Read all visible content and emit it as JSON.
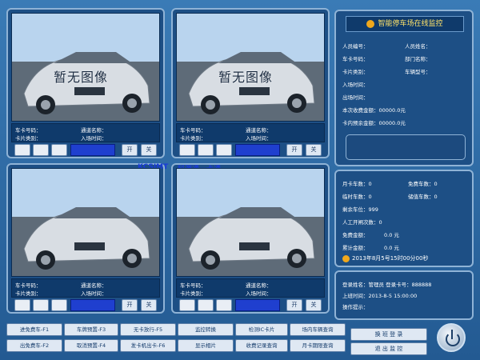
{
  "cams": [
    {
      "overlay": "暂无图像",
      "plate_label": "车卡号码：",
      "channel_label": "通道名称：",
      "cardtype_label": "卡片类别：",
      "entry_label": "入场时间：",
      "tag": ""
    },
    {
      "overlay": "暂无图像",
      "plate_label": "车卡号码：",
      "channel_label": "通道名称：",
      "cardtype_label": "卡片类别：",
      "entry_label": "入场时间：",
      "tag": ""
    },
    {
      "overlay": "",
      "plate_label": "车卡号码：",
      "channel_label": "通道名称：",
      "cardtype_label": "卡片类别：",
      "entry_label": "入场时间：",
      "tag": "KCSIMT"
    },
    {
      "overlay": "",
      "plate_label": "车卡号码：",
      "channel_label": "通道名称：",
      "cardtype_label": "卡片类别：",
      "entry_label": "入场时间：",
      "tag": "科源通一卡通"
    }
  ],
  "cam_buttons": {
    "open": "开",
    "close": "关"
  },
  "monitor": {
    "title": "智能停车场在线监控",
    "rows": [
      [
        "人员编号：",
        "人员姓名："
      ],
      [
        "车卡号码：",
        "部门名称："
      ],
      [
        "卡片类别：",
        "车辆型号："
      ],
      [
        "入场时间：",
        ""
      ],
      [
        "出场时间：",
        ""
      ],
      [
        "本次收费金额：00000.0元",
        ""
      ],
      [
        "卡内预余金额：00000.0元",
        ""
      ]
    ]
  },
  "stats": {
    "rows": [
      [
        "月卡车数：0",
        "免费车数：0"
      ],
      [
        "临时车数：0",
        "储值车数：0"
      ],
      [
        "剩余车位：999",
        ""
      ],
      [
        "人工开闸次数：0",
        ""
      ],
      [
        "免费金额：",
        "0.0  元"
      ],
      [
        "累计金额：",
        "0.0  元"
      ]
    ],
    "datetime": "2013年8月5号15时00分00秒"
  },
  "login": {
    "user": "登录姓名：管理员   登录卡号：888888",
    "shift": "上班时间：2013-8-5  15:00:00",
    "tip": "操作提示："
  },
  "buttons": [
    "进免费车-F1",
    "车牌预置-F3",
    "无卡放行-F5",
    "监控转换",
    "检测IC卡片",
    "场内车辆查询",
    "出免费车-F2",
    "取消预置-F4",
    "发卡机出卡-F6",
    "显示相片",
    "收费记录查询",
    "月卡期限查询"
  ],
  "right_buttons": [
    "换 班 登 录",
    "退 出 监 控"
  ]
}
